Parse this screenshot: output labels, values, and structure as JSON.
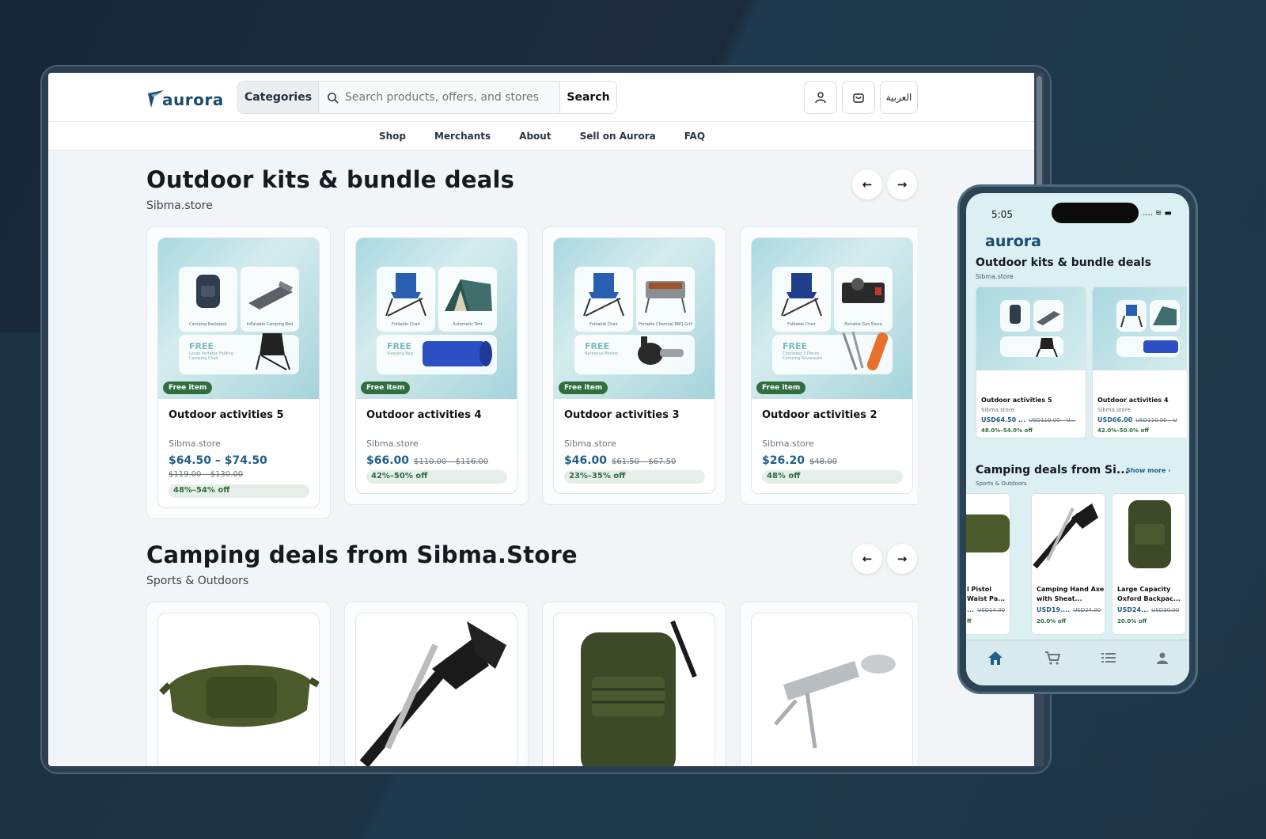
{
  "desktop": {
    "logo_text": "aurora",
    "search": {
      "categories_label": "Categories",
      "placeholder": "Search products, offers, and stores",
      "button_label": "Search"
    },
    "header_icons": {
      "account_icon": "user-icon",
      "cart_icon": "bag-icon",
      "language_label": "العربية"
    },
    "nav": [
      "Shop",
      "Merchants",
      "About",
      "Sell on Aurora",
      "FAQ"
    ],
    "section1": {
      "title": "Outdoor kits & bundle deals",
      "subtitle": "Sibma.store",
      "cards": [
        {
          "title": "Outdoor activities 5",
          "store": "Sibma.store",
          "price": "$64.50 – $74.50",
          "old_price": "$119.00 – $130.00",
          "discount": "48%–54% off",
          "badge": "Free item",
          "tiles": [
            "Camping Backpack",
            "Inflatable Camping Bed"
          ],
          "free_label": "FREE",
          "free_item": "Large Portable Folding Camping Chair"
        },
        {
          "title": "Outdoor activities 4",
          "store": "Sibma.store",
          "price": "$66.00",
          "old_price": "$110.00 – $116.00",
          "discount": "42%–50% off",
          "badge": "Free item",
          "tiles": [
            "Foldable Chair",
            "Automatic Tent"
          ],
          "free_label": "FREE",
          "free_item": "Sleeping Bag"
        },
        {
          "title": "Outdoor activities 3",
          "store": "Sibma.store",
          "price": "$46.00",
          "old_price": "$61.50 – $67.50",
          "discount": "23%–35% off",
          "badge": "Free item",
          "tiles": [
            "Foldable Chair",
            "Portable Charcoal BBQ Grill"
          ],
          "free_label": "FREE",
          "free_item": "Barbecue Blower"
        },
        {
          "title": "Outdoor activities 2",
          "store": "Sibma.store",
          "price": "$26.20",
          "old_price": "$48.00",
          "discount": "48% off",
          "badge": "Free item",
          "tiles": [
            "Foldable Chair",
            "Portable Gas Stove"
          ],
          "free_label": "FREE",
          "free_item": "Choradag 3 Pieces Camping Silverware"
        }
      ]
    },
    "section2": {
      "title": "Camping deals from Sibma.Store",
      "subtitle": "Sports & Outdoors"
    }
  },
  "phone": {
    "time": "5:05",
    "status": "....  ≋ ▬",
    "logo_text": "aurora",
    "section1_title": "Outdoor kits & bundle deals",
    "section1_sub": "Sibma.store",
    "cards": [
      {
        "title": "Outdoor activities 5",
        "store": "Sibma.store",
        "price": "USD64.50 ...",
        "old": "USD119.00 – U...",
        "discount": "48.0%–54.0% off"
      },
      {
        "title": "Outdoor activities 4",
        "store": "Sibma.store",
        "price": "USD66.00",
        "old": "USD110.00 – U",
        "discount": "42.0%–50.0% off"
      }
    ],
    "section2_title": "Camping deals from Si...",
    "show_more": "Show more ›",
    "section2_sub": "Sports & Outdoors",
    "products": [
      {
        "title": "l Pistol Waist Pa...",
        "price": "...",
        "old": "USD14.00",
        "discount": "ff"
      },
      {
        "title": "Camping Hand Axe with Sheat...",
        "price": "USD19....",
        "old": "USD24.00",
        "discount": "20.0% off"
      },
      {
        "title": "Large Capacity Oxford Backpac...",
        "price": "USD24...",
        "old": "USD30.00",
        "discount": "20.0% off"
      }
    ],
    "tabs": [
      "home-icon",
      "cart-icon",
      "list-icon",
      "profile-icon"
    ]
  },
  "colors": {
    "accent": "#1f5f88",
    "discount_green": "#2e6c3d",
    "badge_green": "#2f6e3d",
    "background": "#1c2a3a"
  }
}
